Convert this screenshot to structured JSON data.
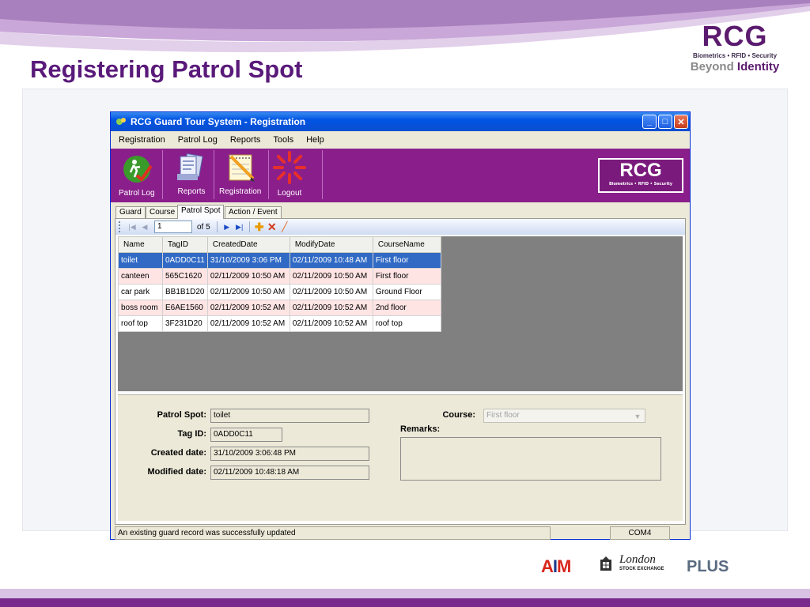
{
  "slide": {
    "title": "Registering Patrol Spot",
    "logo": {
      "word": "RCG",
      "tagline": "Biometrics • RFID • Security",
      "beyond_1": "Beyond ",
      "beyond_2": "Identity"
    },
    "colors": {
      "title": "#5a1a7a",
      "toolbar": "#8a1f8c",
      "selected_row": "#316ac5",
      "alt_row": "#ffe4e4"
    }
  },
  "window": {
    "title": "RCG Guard Tour System - Registration",
    "menu": [
      "Registration",
      "Patrol Log",
      "Reports",
      "Tools",
      "Help"
    ],
    "toolbar": {
      "items": [
        {
          "label": "Patrol Log",
          "icon": "runner-check-icon"
        },
        {
          "label": "Reports",
          "icon": "reports-icon"
        },
        {
          "label": "Registration",
          "icon": "registration-notepad-icon"
        },
        {
          "label": "Logout",
          "icon": "logout-icon"
        }
      ],
      "brand": {
        "word": "RCG",
        "tagline": "Biometrics • RFID • Security"
      }
    },
    "tabs": [
      "Guard",
      "Course",
      "Patrol Spot",
      "Action / Event"
    ],
    "active_tab": "Patrol Spot",
    "navigator": {
      "position": "1",
      "count": "of 5"
    },
    "grid": {
      "columns": [
        "Name",
        "TagID",
        "CreatedDate",
        "ModifyDate",
        "CourseName"
      ],
      "rows": [
        [
          "toilet",
          "0ADD0C11",
          "31/10/2009 3:06 PM",
          "02/11/2009 10:48 AM",
          "First floor"
        ],
        [
          "canteen",
          "565C1620",
          "02/11/2009 10:50 AM",
          "02/11/2009 10:50 AM",
          "First floor"
        ],
        [
          "car park",
          "BB1B1D20",
          "02/11/2009 10:50 AM",
          "02/11/2009 10:50 AM",
          "Ground Floor"
        ],
        [
          "boss room",
          "E6AE1560",
          "02/11/2009 10:52 AM",
          "02/11/2009 10:52 AM",
          "2nd floor"
        ],
        [
          "roof top",
          "3F231D20",
          "02/11/2009 10:52 AM",
          "02/11/2009 10:52 AM",
          "roof top"
        ]
      ],
      "selected_row": 0
    },
    "details": {
      "patrol_spot_label": "Patrol Spot:",
      "patrol_spot_value": "toilet",
      "tag_id_label": "Tag ID:",
      "tag_id_value": "0ADD0C11",
      "created_label": "Created date:",
      "created_value": "31/10/2009 3:06:48 PM",
      "modified_label": "Modified date:",
      "modified_value": "02/11/2009 10:48:18 AM",
      "course_label": "Course:",
      "course_value": "First floor",
      "remarks_label": "Remarks:"
    },
    "status": {
      "message": "An existing guard record was successfully updated",
      "port": "COM4"
    }
  },
  "footer": {
    "aim": "AIM",
    "lse_line1": "London",
    "lse_line2": "STOCK EXCHANGE",
    "plus": "PLUS"
  }
}
